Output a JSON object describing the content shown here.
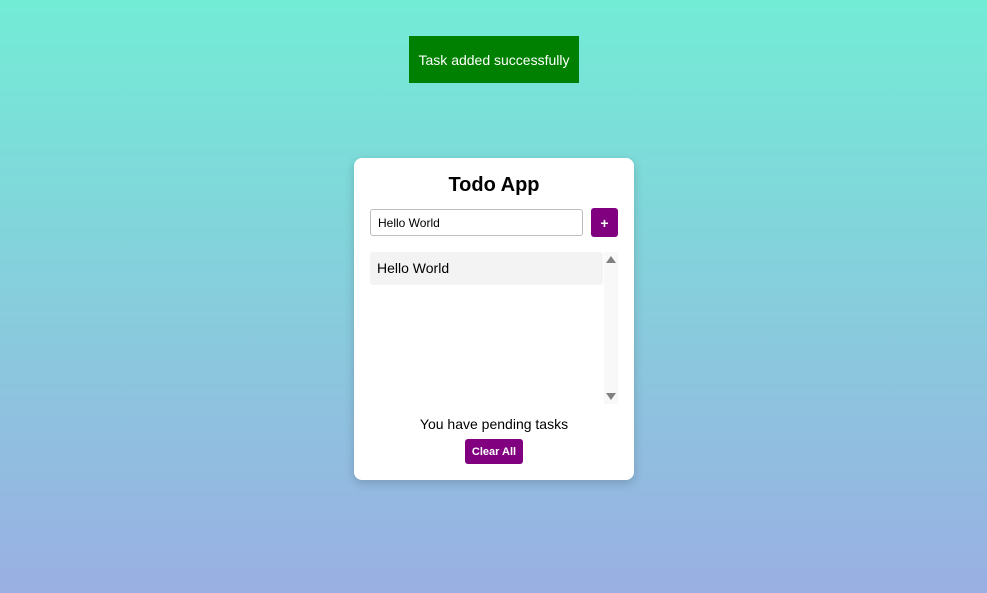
{
  "toast": {
    "message": "Task added successfully",
    "color": "#008000"
  },
  "app": {
    "title": "Todo App",
    "accent_color": "#800080"
  },
  "input": {
    "value": "Hello World"
  },
  "add_button": {
    "label": "+"
  },
  "tasks": [
    {
      "text": "Hello World"
    }
  ],
  "status_text": "You have pending tasks",
  "clear_button": {
    "label": "Clear All"
  }
}
